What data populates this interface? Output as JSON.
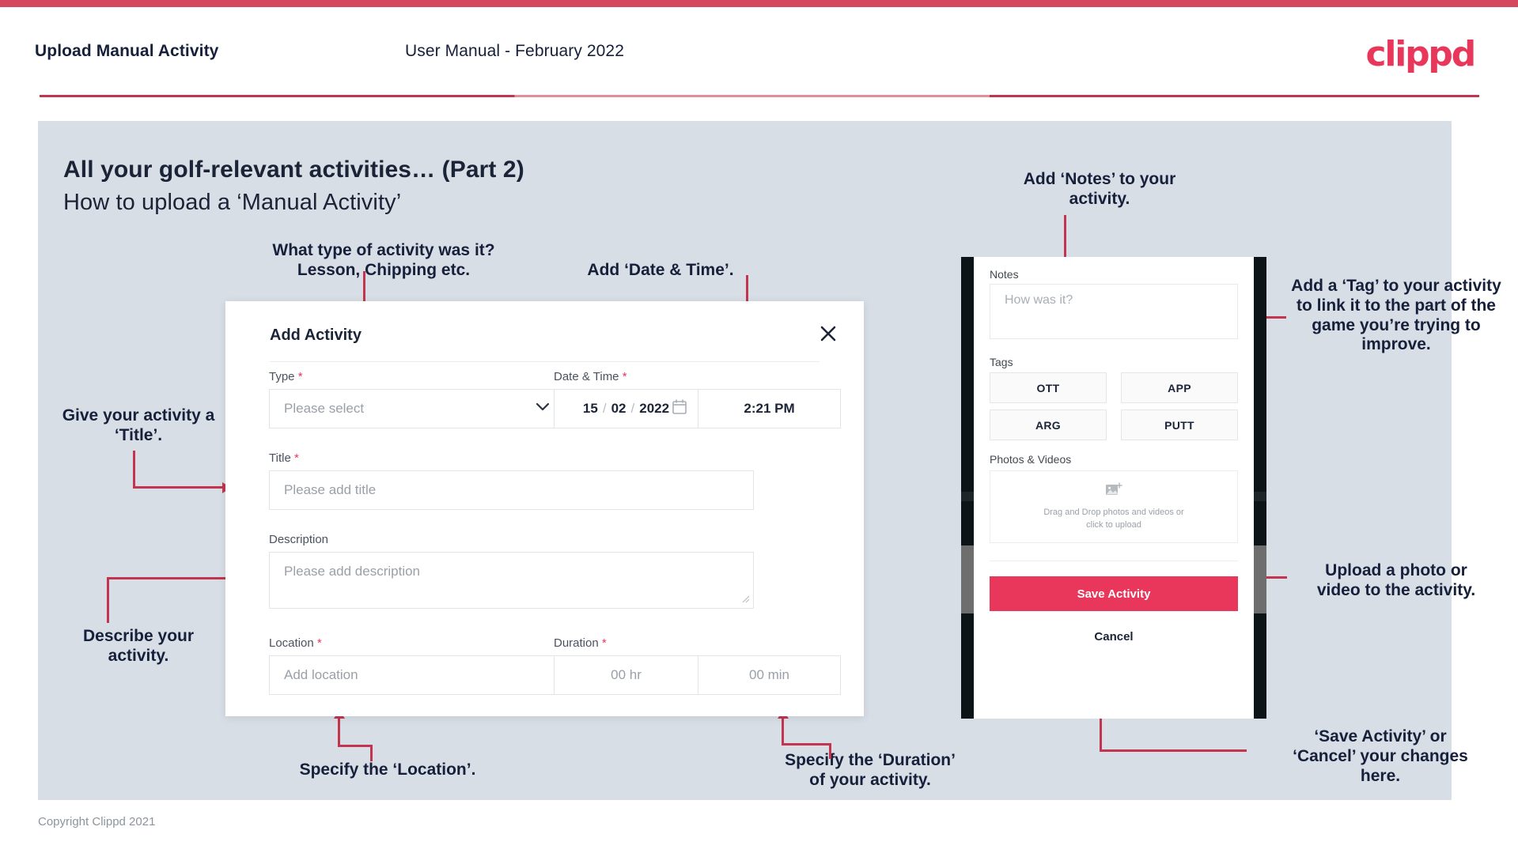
{
  "header": {
    "title": "Upload Manual Activity",
    "subtitle": "User Manual - February 2022",
    "logo": "clippd"
  },
  "slide": {
    "title": "All your golf-relevant activities… (Part 2)",
    "subtitle": "How to upload a ‘Manual Activity’",
    "copyright": "Copyright Clippd 2021"
  },
  "dialog": {
    "title": "Add Activity",
    "close_icon": "close-icon",
    "fields": {
      "type": {
        "label": "Type",
        "required": "*",
        "placeholder": "Please select"
      },
      "datetime": {
        "label": "Date & Time",
        "required": "*",
        "day": "15",
        "month": "02",
        "year": "2022",
        "sep": "/",
        "time": "2:21 PM"
      },
      "title": {
        "label": "Title",
        "required": "*",
        "placeholder": "Please add title"
      },
      "description": {
        "label": "Description",
        "placeholder": "Please add description"
      },
      "location": {
        "label": "Location",
        "required": "*",
        "placeholder": "Add location"
      },
      "duration": {
        "label": "Duration",
        "required": "*",
        "hours": "00 hr",
        "minutes": "00 min"
      }
    }
  },
  "phone": {
    "notes": {
      "label": "Notes",
      "placeholder": "How was it?"
    },
    "tags": {
      "label": "Tags",
      "items": [
        "OTT",
        "APP",
        "ARG",
        "PUTT"
      ]
    },
    "photos": {
      "label": "Photos & Videos",
      "drop_line1": "Drag and Drop photos and videos or",
      "drop_line2": "click to upload",
      "icon": "add-image-icon"
    },
    "save_label": "Save Activity",
    "cancel_label": "Cancel"
  },
  "annotations": {
    "type": "What type of activity was it?\nLesson, Chipping etc.",
    "type_l1": "What type of activity was it?",
    "type_l2": "Lesson, Chipping etc.",
    "datetime": "Add ‘Date & Time’.",
    "title": "Give your activity a\n‘Title’.",
    "title_l1": "Give your activity a",
    "title_l2": "‘Title’.",
    "description_l1": "Describe your",
    "description_l2": "activity.",
    "location": "Specify the ‘Location’.",
    "duration_l1": "Specify the ‘Duration’",
    "duration_l2": "of your activity.",
    "notes_l1": "Add ‘Notes’ to your",
    "notes_l2": "activity.",
    "tags": "Add a ‘Tag’ to your activity to link it to the part of the game you’re trying to improve.",
    "upload_l1": "Upload a photo or",
    "upload_l2": "video to the activity.",
    "save_l1": "‘Save Activity’ or",
    "save_l2": "‘Cancel’ your changes",
    "save_l3": "here."
  },
  "colors": {
    "brand": "#e8375a",
    "accent_line": "#c3354f",
    "stage_bg": "#d8dee6",
    "text": "#1b2437"
  }
}
